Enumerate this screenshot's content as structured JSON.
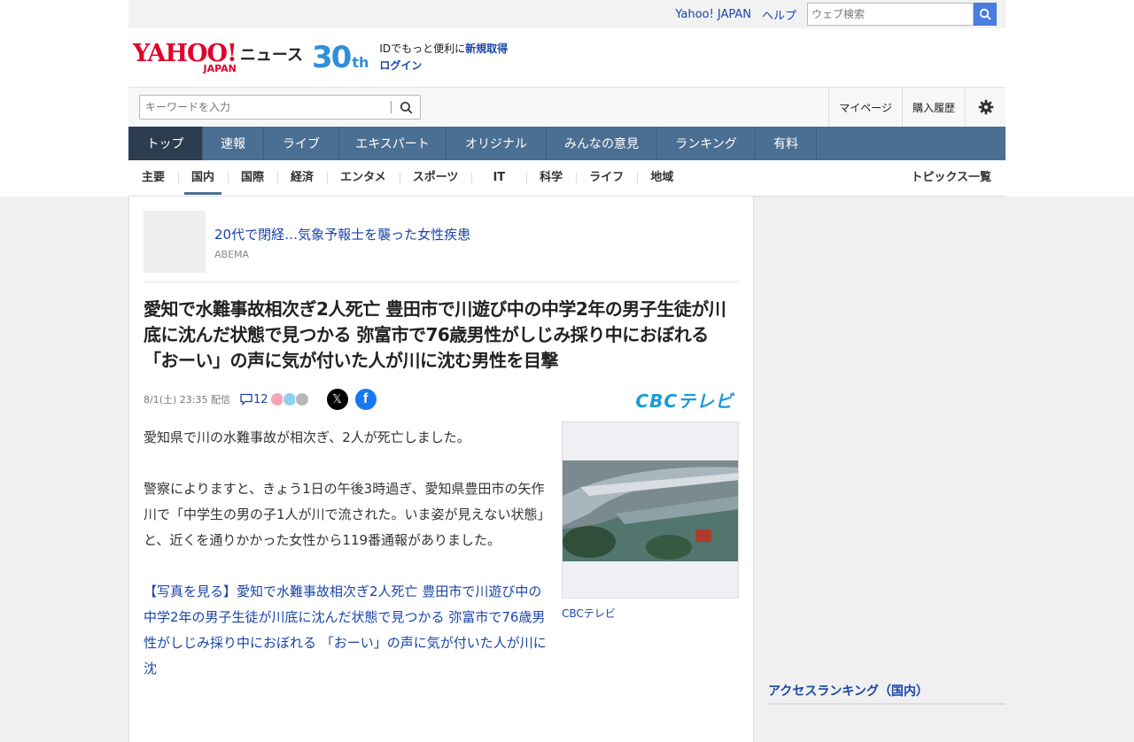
{
  "topbar": {
    "links": [
      "Yahoo! JAPAN",
      "ヘルプ"
    ],
    "search_placeholder": "ウェブ検索"
  },
  "header": {
    "logo_yahoo": "YAHOO!",
    "logo_japan": "JAPAN",
    "logo_news": "ニュース",
    "anniv_num": "30",
    "anniv_suffix": "th",
    "id_text": "IDでもっと便利に",
    "register": "新規取得",
    "login": "ログイン"
  },
  "subhead": {
    "search_placeholder": "キーワードを入力",
    "mypage": "マイページ",
    "purchase": "購入履歴"
  },
  "globalnav": [
    "トップ",
    "速報",
    "ライブ",
    "エキスパート",
    "オリジナル",
    "みんなの意見",
    "ランキング",
    "有料"
  ],
  "catnav": {
    "items": [
      "主要",
      "国内",
      "国際",
      "経済",
      "エンタメ",
      "スポーツ",
      "IT",
      "科学",
      "ライフ",
      "地域"
    ],
    "topics": "トピックス一覧"
  },
  "promo": {
    "title": "20代で閉経…気象予報士を襲った女性疾患",
    "source": "ABEMA"
  },
  "article": {
    "headline": "愛知で水難事故相次ぎ2人死亡 豊田市で川遊び中の中学2年の男子生徒が川底に沈んだ状態で見つかる 弥富市で76歳男性がしじみ採り中におぼれる 「おーい」の声に気が付いた人が川に沈む男性を目撃",
    "date": "8/1(土) 23:35 配信",
    "comment_count": "12",
    "publisher_logo": "CBCテレビ",
    "paragraphs": [
      "愛知県で川の水難事故が相次ぎ、2人が死亡しました。",
      "警察によりますと、きょう1日の午後3時過ぎ、愛知県豊田市の矢作川で「中学生の男の子1人が川で流された。いま姿が見えない状態」と、近くを通りかかった女性から119番通報がありました。"
    ],
    "photo_link": "【写真を見る】愛知で水難事故相次ぎ2人死亡 豊田市で川遊び中の中学2年の男子生徒が川底に沈んだ状態で見つかる 弥富市で76歳男性がしじみ採り中におぼれる 「おーい」の声に気が付いた人が川に沈",
    "photo_caption": "CBCテレビ"
  },
  "sidebar": {
    "ranking_title": "アクセスランキング（国内）"
  },
  "colors": {
    "nav": "#4b6f93",
    "nav_active": "#2d3d51",
    "link": "#1a45a8",
    "logo_red": "#e0002a"
  }
}
